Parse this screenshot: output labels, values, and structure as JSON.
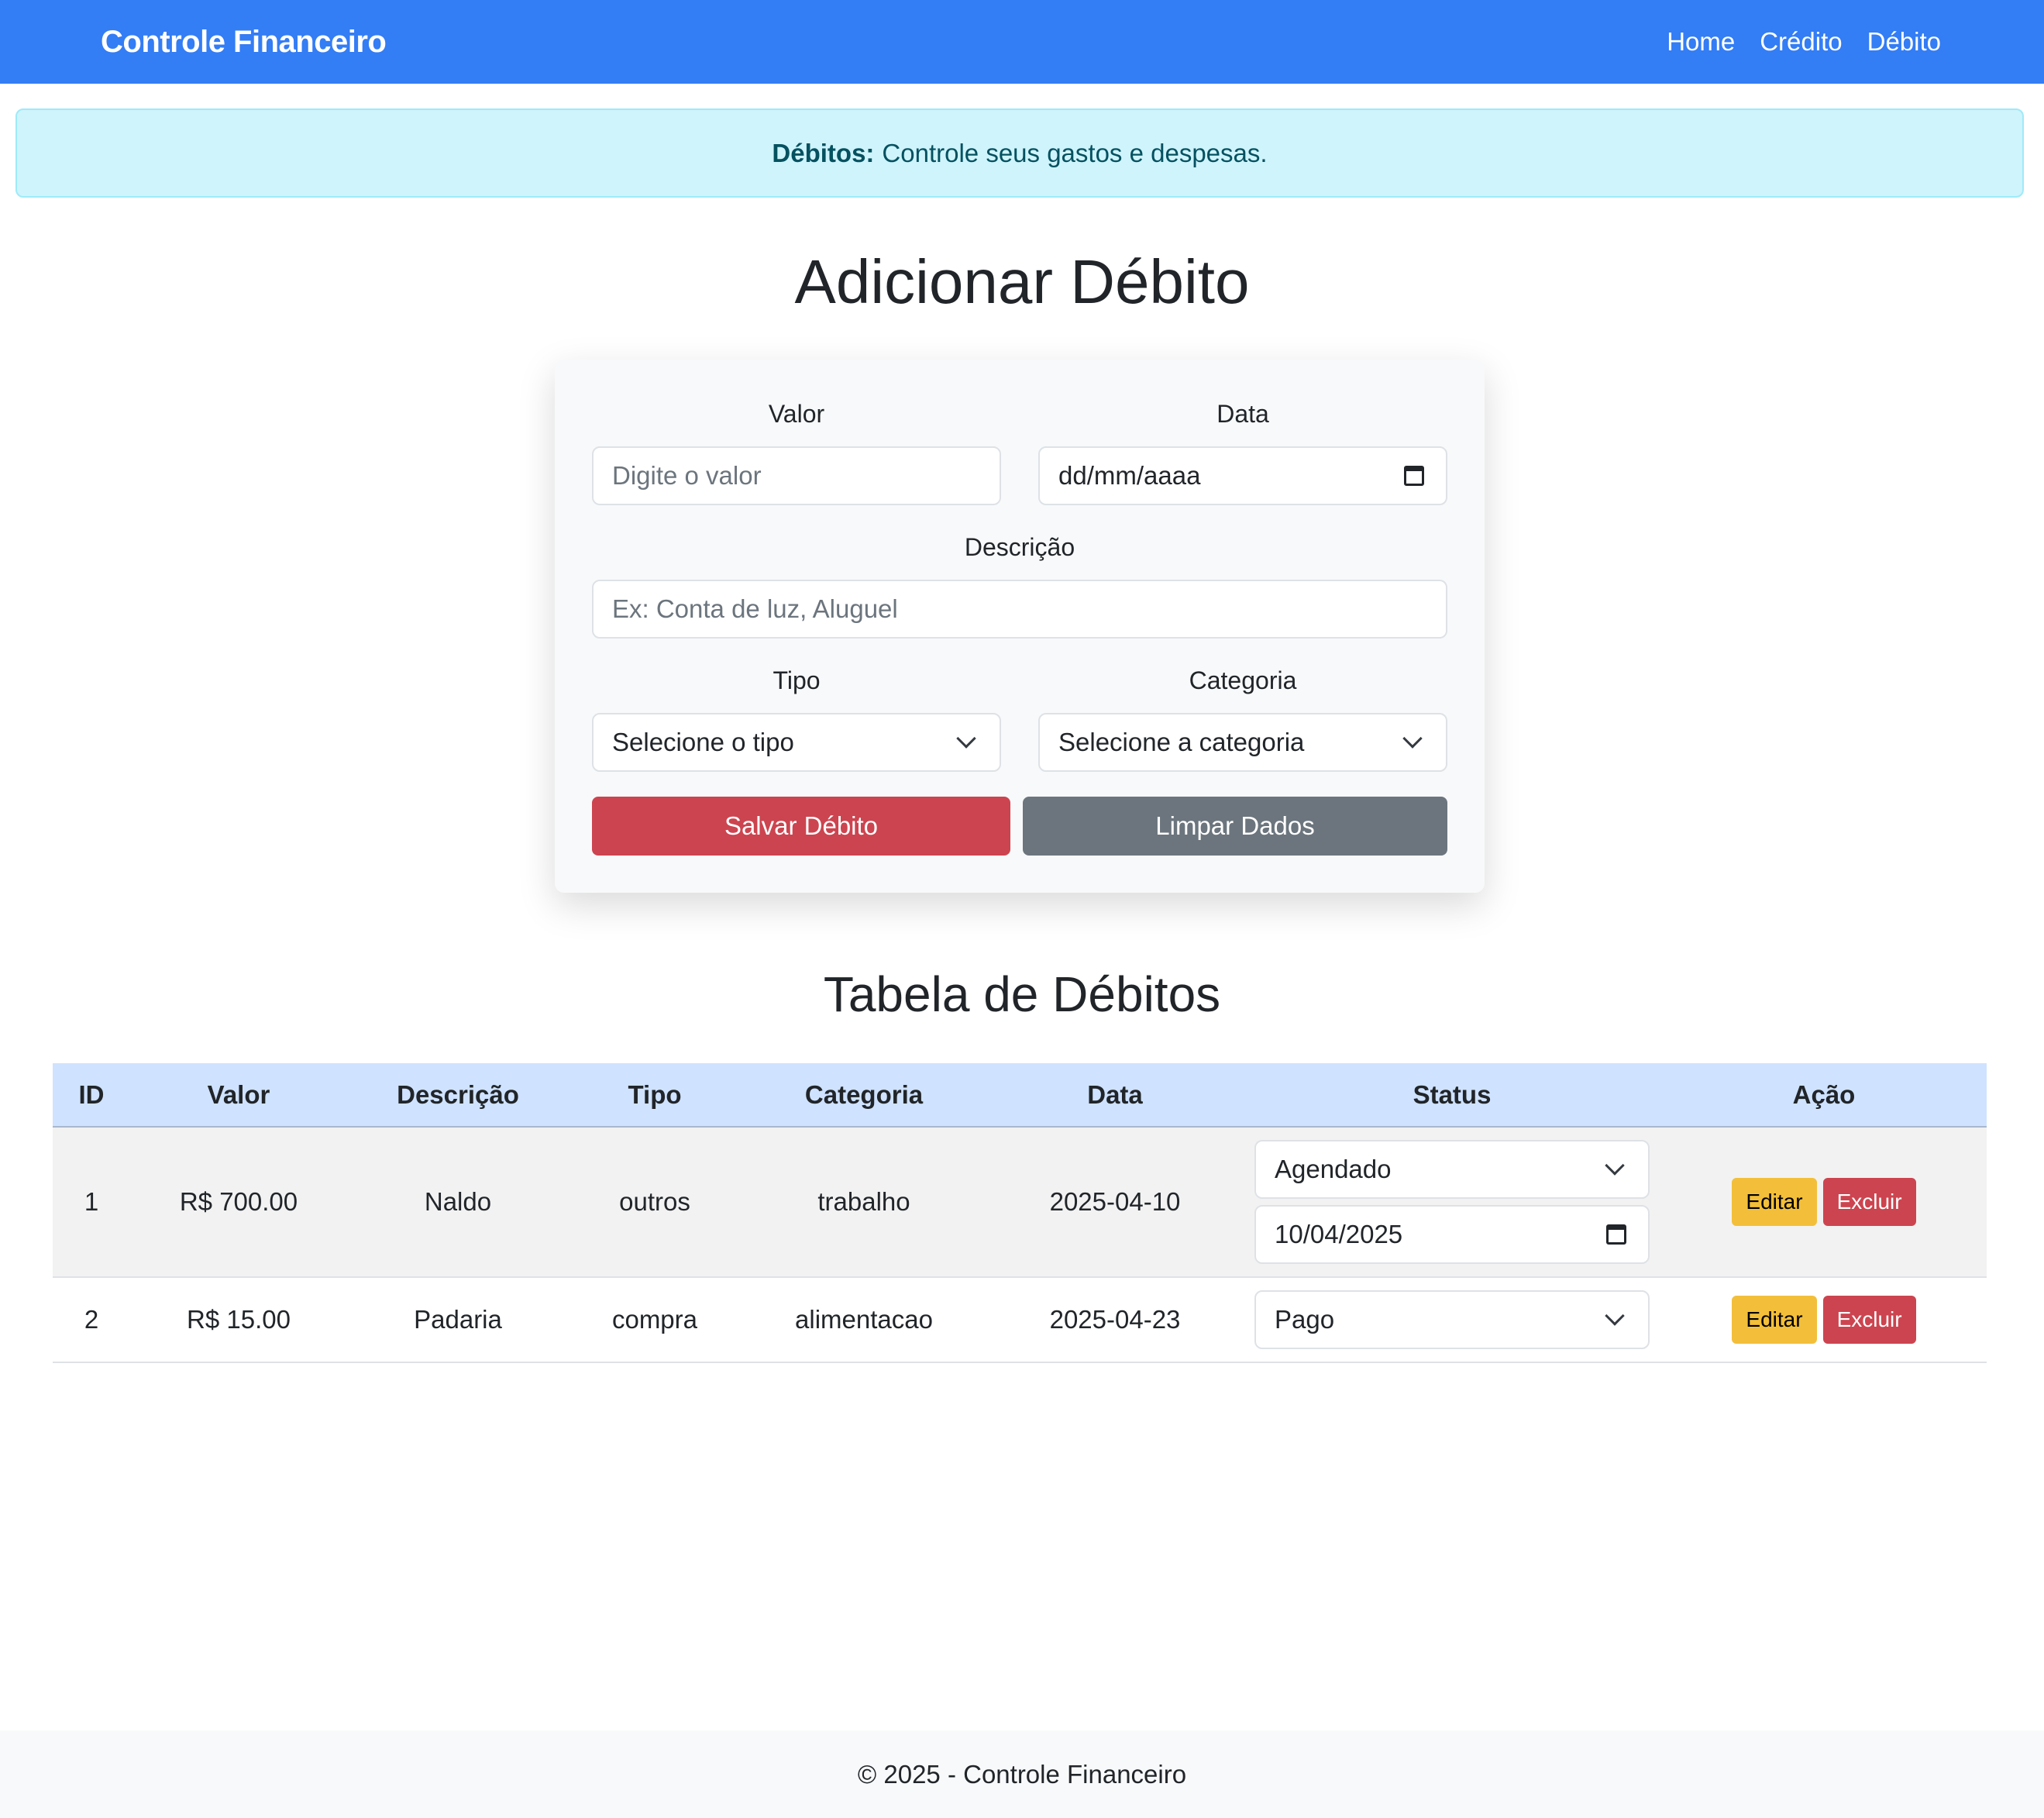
{
  "navbar": {
    "brand": "Controle Financeiro",
    "links": [
      "Home",
      "Crédito",
      "Débito"
    ]
  },
  "alert": {
    "lead": "Débitos:",
    "text": "Controle seus gastos e despesas."
  },
  "form": {
    "title": "Adicionar Débito",
    "valor_label": "Valor",
    "valor_placeholder": "Digite o valor",
    "data_label": "Data",
    "data_value": "dd/mm/aaaa",
    "descricao_label": "Descrição",
    "descricao_placeholder": "Ex: Conta de luz, Aluguel",
    "tipo_label": "Tipo",
    "tipo_value": "Selecione o tipo",
    "categoria_label": "Categoria",
    "categoria_value": "Selecione a categoria",
    "save_label": "Salvar Débito",
    "clear_label": "Limpar Dados"
  },
  "table": {
    "title": "Tabela de Débitos",
    "headers": [
      "ID",
      "Valor",
      "Descrição",
      "Tipo",
      "Categoria",
      "Data",
      "Status",
      "Ação"
    ],
    "rows": [
      {
        "id": "1",
        "valor": "R$ 700.00",
        "descricao": "Naldo",
        "tipo": "outros",
        "categoria": "trabalho",
        "data": "2025-04-10",
        "status": "Agendado",
        "status_date": "10/04/2025"
      },
      {
        "id": "2",
        "valor": "R$ 15.00",
        "descricao": "Padaria",
        "tipo": "compra",
        "categoria": "alimentacao",
        "data": "2025-04-23",
        "status": "Pago"
      }
    ],
    "edit_label": "Editar",
    "delete_label": "Excluir"
  },
  "footer": {
    "text": "© 2025 - Controle Financeiro"
  },
  "colors": {
    "navbar": "#337df5",
    "alert_bg": "#cff4fc",
    "danger": "#cc444f",
    "secondary": "#6c757d",
    "warning": "#f3bf3a",
    "table_header": "#cfe2ff"
  }
}
